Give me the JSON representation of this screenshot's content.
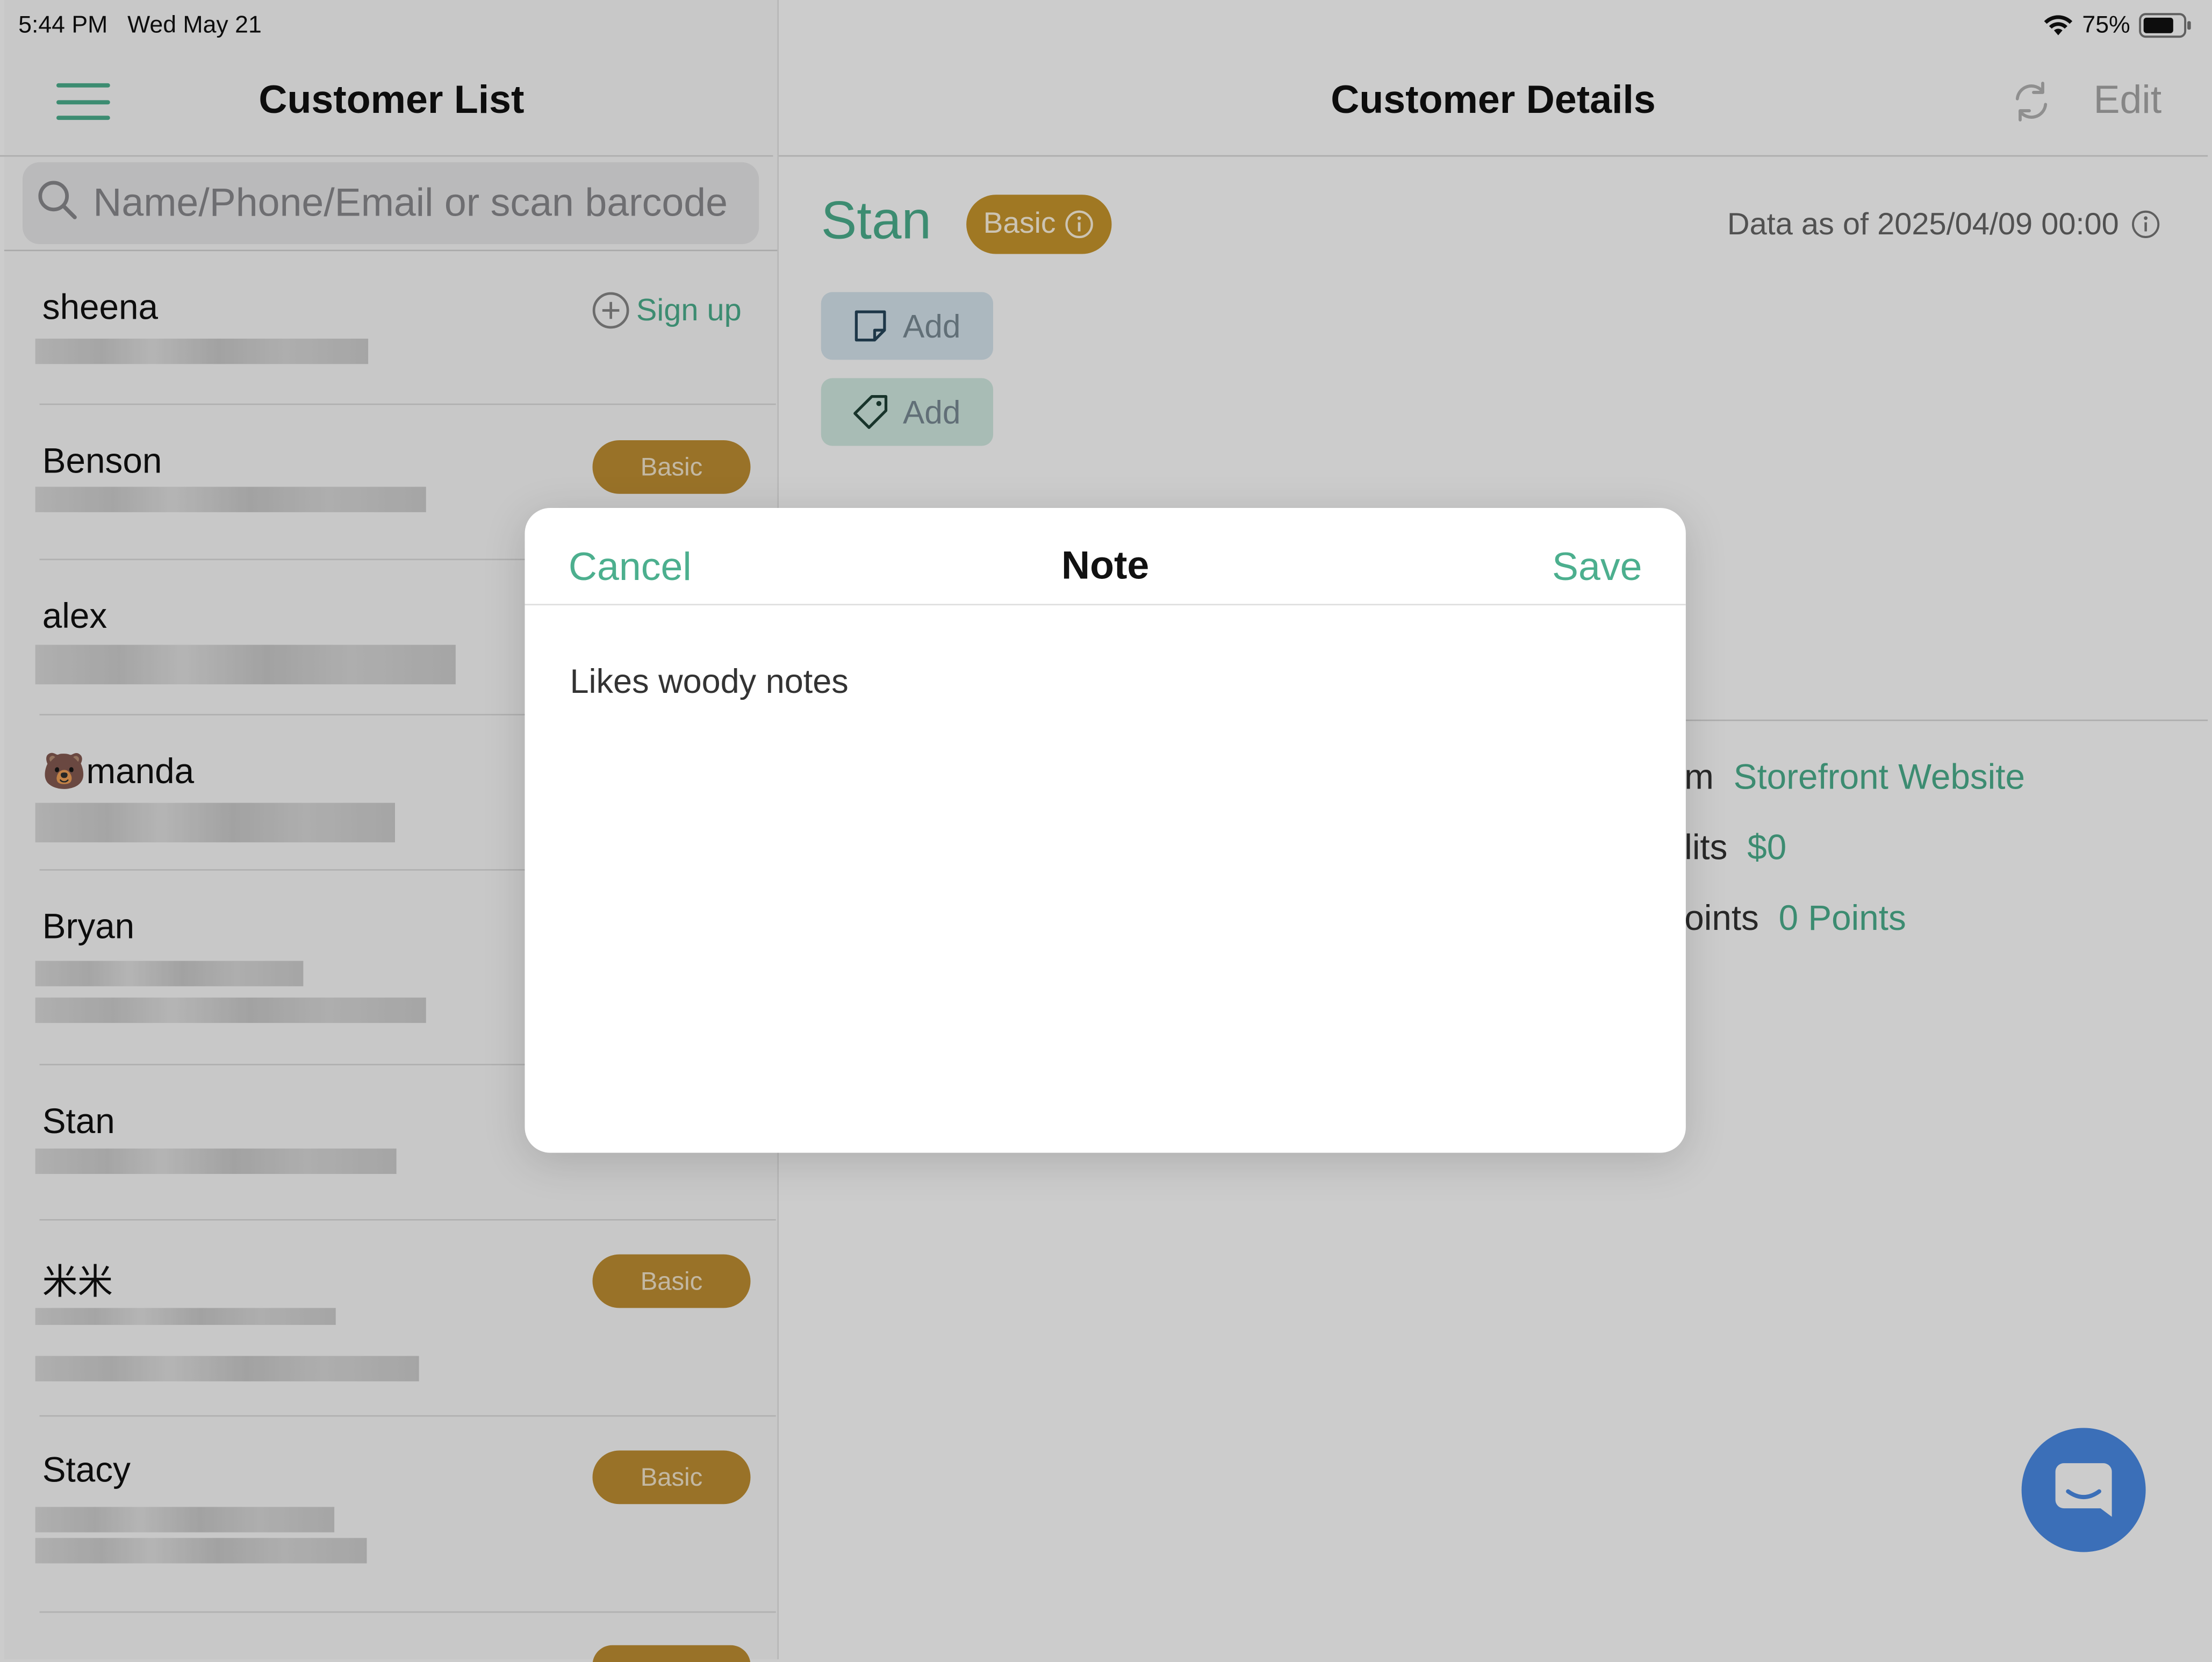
{
  "status_bar": {
    "time": "5:44 PM",
    "date": "Wed May 21",
    "battery": "75%"
  },
  "left_panel": {
    "title": "Customer List",
    "search_placeholder": "Name/Phone/Email or scan barcode",
    "customers": [
      {
        "name": "sheena",
        "action": "Sign up"
      },
      {
        "name": "Benson",
        "badge": "Basic"
      },
      {
        "name": "alex"
      },
      {
        "name": "🐻manda"
      },
      {
        "name": "Bryan"
      },
      {
        "name": "Stan"
      },
      {
        "name": "米米",
        "badge": "Basic"
      },
      {
        "name": "Stacy",
        "badge": "Basic"
      }
    ]
  },
  "right_panel": {
    "title": "Customer Details",
    "edit_label": "Edit",
    "customer_name": "Stan",
    "tier_badge": "Basic",
    "data_as_of": "Data as of 2025/04/09 00:00",
    "add_note_label": "Add",
    "add_tag_label": "Add",
    "info": [
      {
        "label_fragment": "m",
        "value": "Storefront Website"
      },
      {
        "label_fragment": "lits",
        "value": "$0"
      },
      {
        "label_fragment": "oints",
        "value": "0 Points"
      }
    ]
  },
  "modal": {
    "title": "Note",
    "cancel_label": "Cancel",
    "save_label": "Save",
    "note_text": "Likes woody notes"
  },
  "colors": {
    "accent_green": "#4caf8e",
    "badge_gold": "#c08f33",
    "chat_blue": "#4a8be6"
  }
}
